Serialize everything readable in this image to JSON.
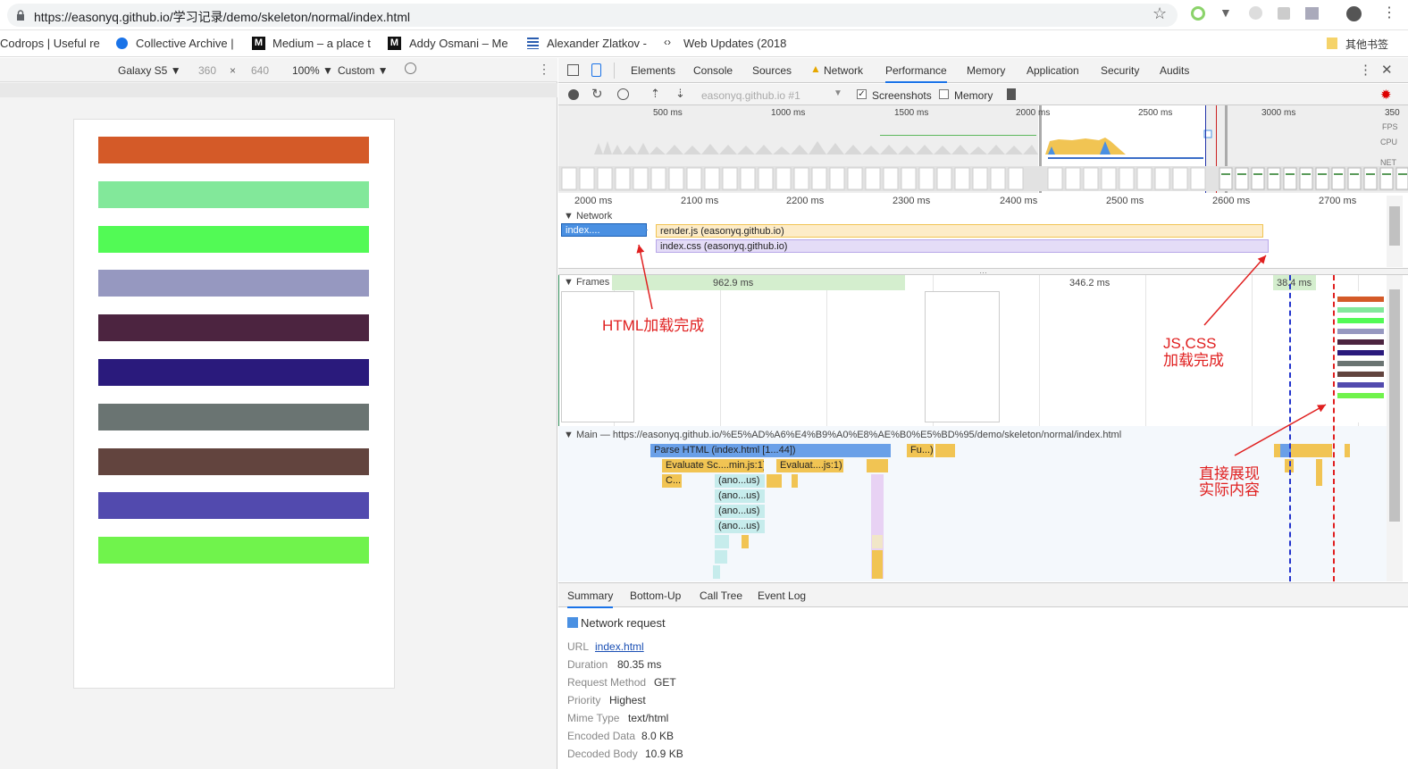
{
  "browser": {
    "url": "https://easonyq.github.io/学习记录/demo/skeleton/normal/index.html",
    "bookmarks": [
      "Codrops | Useful re",
      "Collective Archive |",
      "Medium – a place t",
      "Addy Osmani – Me",
      "Alexander Zlatkov -",
      "Web Updates (2018",
      "其他书签"
    ]
  },
  "device_toolbar": {
    "device": "Galaxy S5 ▼",
    "width": "360",
    "x": "×",
    "height": "640",
    "zoom": "100% ▼",
    "throttle": "Custom ▼"
  },
  "page_bars": [
    "#d45a28",
    "#82e89a",
    "#52fa55",
    "#9698c0",
    "#4c2440",
    "#2a1a7c",
    "#6a7472",
    "#62443e",
    "#524aae",
    "#70f34c"
  ],
  "devtools": {
    "tabs": [
      "Elements",
      "Console",
      "Sources",
      "Network",
      "Performance",
      "Memory",
      "Application",
      "Security",
      "Audits"
    ],
    "active_tab": "Performance",
    "perf_toolbar": {
      "target": "easonyq.github.io #1",
      "screenshots": "Screenshots",
      "memory": "Memory"
    },
    "overview_ticks": [
      "500 ms",
      "1000 ms",
      "1500 ms",
      "2000 ms",
      "2500 ms",
      "3000 ms",
      "350"
    ],
    "overview_labels": [
      "FPS",
      "CPU",
      "NET"
    ],
    "timeline_ticks": [
      "2000 ms",
      "2100 ms",
      "2200 ms",
      "2300 ms",
      "2400 ms",
      "2500 ms",
      "2600 ms",
      "2700 ms"
    ],
    "network_label": "▼ Network",
    "network_items": [
      "index....",
      "render.js (easonyq.github.io)",
      "index.css (easonyq.github.io)"
    ],
    "frames_label": "▼ Frames",
    "frame_durations": [
      "962.9 ms",
      "346.2 ms",
      "38.4 ms"
    ],
    "main_label": "▼ Main — https://easonyq.github.io/%E5%AD%A6%E4%B9%A0%E8%AE%B0%E5%BD%95/demo/skeleton/normal/index.html",
    "flame_blocks": [
      "Parse HTML (index.html [1...44])",
      "Fu...)",
      "Evaluate Sc....min.js:1)",
      "Evaluat....js:1)",
      "C...",
      "(ano...us)",
      "(ano...us)",
      "(ano...us)",
      "(ano...us)"
    ],
    "summary_tabs": [
      "Summary",
      "Bottom-Up",
      "Call Tree",
      "Event Log"
    ],
    "summary": {
      "title": "Network request",
      "rows": [
        {
          "label": "URL",
          "value": "index.html"
        },
        {
          "label": "Duration",
          "value": "80.35 ms"
        },
        {
          "label": "Request Method",
          "value": "GET"
        },
        {
          "label": "Priority",
          "value": "Highest"
        },
        {
          "label": "Mime Type",
          "value": "text/html"
        },
        {
          "label": "Encoded Data",
          "value": "8.0 KB"
        },
        {
          "label": "Decoded Body",
          "value": "10.9 KB"
        }
      ]
    }
  },
  "annotations": {
    "html_loaded": "HTML加载完成",
    "jscss_1": "JS,CSS",
    "jscss_2": "加载完成",
    "real_1": "直接展现",
    "real_2": "实际内容"
  }
}
